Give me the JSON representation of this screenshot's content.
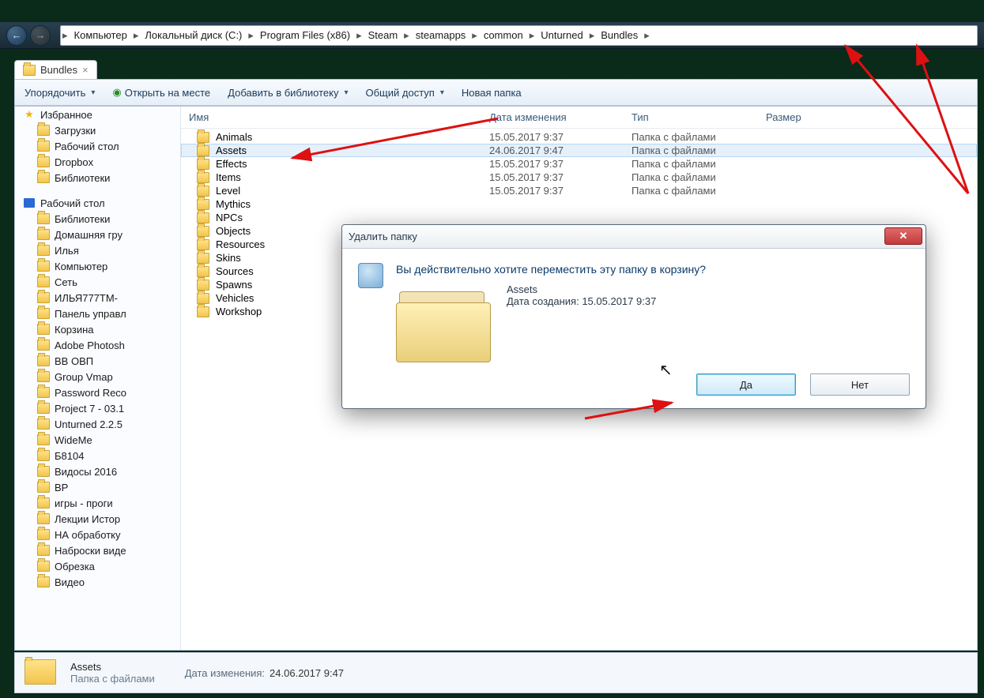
{
  "nav": {
    "back_glyph": "←",
    "fwd_glyph": "→"
  },
  "breadcrumb": [
    "Компьютер",
    "Локальный диск (C:)",
    "Program Files (x86)",
    "Steam",
    "steamapps",
    "common",
    "Unturned",
    "Bundles"
  ],
  "tab": {
    "label": "Bundles"
  },
  "toolbar": {
    "organize": "Упорядочить",
    "open_in_place": "Открыть на месте",
    "add_to_library": "Добавить в библиотеку",
    "share": "Общий доступ",
    "new_folder": "Новая папка"
  },
  "columns": {
    "name": "Имя",
    "modified": "Дата изменения",
    "type": "Тип",
    "size": "Размер"
  },
  "files": [
    {
      "name": "Animals",
      "date": "15.05.2017 9:37",
      "type": "Папка с файлами"
    },
    {
      "name": "Assets",
      "date": "24.06.2017 9:47",
      "type": "Папка с файлами",
      "selected": true
    },
    {
      "name": "Effects",
      "date": "15.05.2017 9:37",
      "type": "Папка с файлами"
    },
    {
      "name": "Items",
      "date": "15.05.2017 9:37",
      "type": "Папка с файлами"
    },
    {
      "name": "Level",
      "date": "15.05.2017 9:37",
      "type": "Папка с файлами"
    },
    {
      "name": "Mythics",
      "date": "",
      "type": ""
    },
    {
      "name": "NPCs",
      "date": "",
      "type": ""
    },
    {
      "name": "Objects",
      "date": "",
      "type": ""
    },
    {
      "name": "Resources",
      "date": "",
      "type": ""
    },
    {
      "name": "Skins",
      "date": "",
      "type": ""
    },
    {
      "name": "Sources",
      "date": "",
      "type": ""
    },
    {
      "name": "Spawns",
      "date": "",
      "type": ""
    },
    {
      "name": "Vehicles",
      "date": "",
      "type": ""
    },
    {
      "name": "Workshop",
      "date": "",
      "type": ""
    }
  ],
  "sidebar": {
    "favorites_header": "Избранное",
    "favorites": [
      {
        "label": "Загрузки"
      },
      {
        "label": "Рабочий стол"
      },
      {
        "label": "Dropbox"
      },
      {
        "label": "Библиотеки"
      }
    ],
    "desktop_header": "Рабочий стол",
    "desktop": [
      {
        "label": "Библиотеки"
      },
      {
        "label": "Домашняя гру"
      },
      {
        "label": "Илья"
      },
      {
        "label": "Компьютер"
      },
      {
        "label": "Сеть"
      },
      {
        "label": "ИЛЬЯ777TM-"
      },
      {
        "label": "Панель управл"
      },
      {
        "label": "Корзина"
      },
      {
        "label": "Adobe Photosh"
      },
      {
        "label": "BB ОВП"
      },
      {
        "label": "Group Vmap"
      },
      {
        "label": "Password Reco"
      },
      {
        "label": "Project 7 - 03.1"
      },
      {
        "label": "Unturned 2.2.5"
      },
      {
        "label": "WideMe"
      },
      {
        "label": "Б8104"
      },
      {
        "label": "Видосы 2016"
      },
      {
        "label": "ВР"
      },
      {
        "label": "игры - проги"
      },
      {
        "label": "Лекции Истор"
      },
      {
        "label": "НА обработку"
      },
      {
        "label": "Наброски виде"
      },
      {
        "label": "Обрезка"
      },
      {
        "label": "Видео"
      }
    ]
  },
  "status": {
    "name": "Assets",
    "type": "Папка с файлами",
    "mod_label": "Дата изменения:",
    "mod_value": "24.06.2017 9:47"
  },
  "dialog": {
    "title": "Удалить папку",
    "message": "Вы действительно хотите переместить эту папку в корзину?",
    "item_name": "Assets",
    "created_label": "Дата создания: 15.05.2017 9:37",
    "yes": "Да",
    "no": "Нет",
    "close_glyph": "✕"
  }
}
